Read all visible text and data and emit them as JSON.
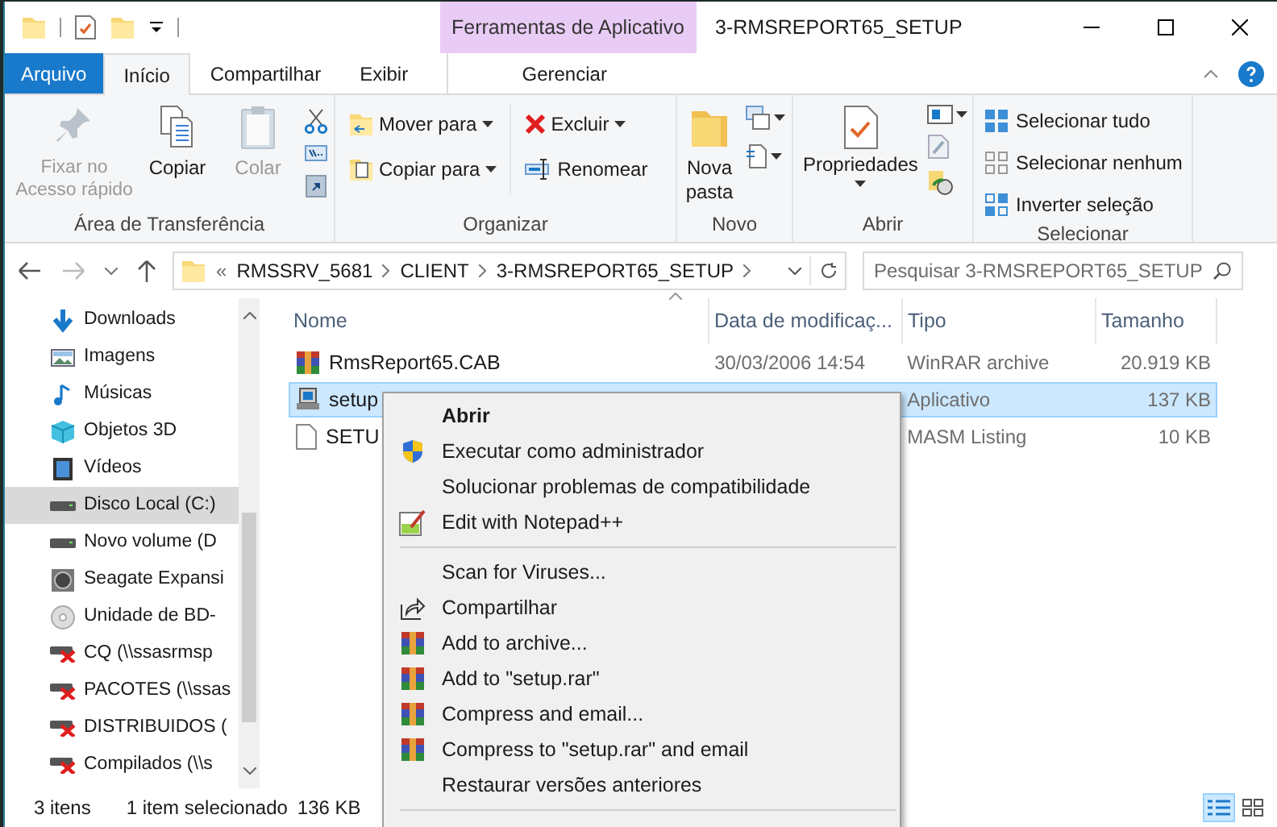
{
  "window": {
    "title": "3-RMSREPORT65_SETUP",
    "contextual_tab_group": "Ferramentas de Aplicativo"
  },
  "ribbon_tabs": [
    {
      "label": "Arquivo",
      "kind": "file",
      "selected": false
    },
    {
      "label": "Início",
      "kind": "tab",
      "selected": true
    },
    {
      "label": "Compartilhar",
      "kind": "tab",
      "selected": false
    },
    {
      "label": "Exibir",
      "kind": "tab",
      "selected": false
    },
    {
      "label": "Gerenciar",
      "kind": "contextual",
      "selected": false
    }
  ],
  "ribbon_groups": {
    "clipboard": {
      "label": "Área de Transferência",
      "buttons": [
        {
          "label": "Fixar no Acesso rápido",
          "disabled": true
        },
        {
          "label": "Copiar",
          "disabled": false
        },
        {
          "label": "Colar",
          "disabled": true
        }
      ]
    },
    "organize": {
      "label": "Organizar",
      "buttons": [
        {
          "label": "Mover para",
          "dropdown": true
        },
        {
          "label": "Copiar para",
          "dropdown": true
        },
        {
          "label": "Excluir",
          "dropdown": true
        },
        {
          "label": "Renomear",
          "dropdown": false
        }
      ]
    },
    "new": {
      "label": "Novo",
      "button": "Nova pasta"
    },
    "open": {
      "label": "Abrir",
      "button": "Propriedades"
    },
    "select": {
      "label": "Selecionar",
      "buttons": [
        "Selecionar tudo",
        "Selecionar nenhum",
        "Inverter seleção"
      ]
    }
  },
  "address_bar": {
    "overflow": "«",
    "path": [
      "RMSSRV_5681",
      "CLIENT",
      "3-RMSREPORT65_SETUP"
    ]
  },
  "search": {
    "placeholder": "Pesquisar 3-RMSREPORT65_SETUP"
  },
  "sidebar": {
    "items": [
      {
        "label": "Downloads",
        "kind": "downloads",
        "selected": false
      },
      {
        "label": "Imagens",
        "kind": "pictures",
        "selected": false
      },
      {
        "label": "Músicas",
        "kind": "music",
        "selected": false
      },
      {
        "label": "Objetos 3D",
        "kind": "objects",
        "selected": false
      },
      {
        "label": "Vídeos",
        "kind": "videos",
        "selected": false
      },
      {
        "label": "Disco Local (C:)",
        "kind": "drive",
        "selected": true
      },
      {
        "label": "Novo volume (D",
        "kind": "drive",
        "selected": false
      },
      {
        "label": "Seagate Expansi",
        "kind": "external",
        "selected": false
      },
      {
        "label": "Unidade de BD-",
        "kind": "disc",
        "selected": false
      },
      {
        "label": "CQ (\\\\ssasrmsp",
        "kind": "network",
        "selected": false
      },
      {
        "label": "PACOTES (\\\\ssas",
        "kind": "network",
        "selected": false
      },
      {
        "label": "DISTRIBUIDOS (",
        "kind": "network",
        "selected": false
      },
      {
        "label": "Compilados (\\\\s",
        "kind": "network",
        "selected": false
      }
    ]
  },
  "table": {
    "columns": [
      "Nome",
      "Data de modificaç...",
      "Tipo",
      "Tamanho"
    ],
    "rows": [
      {
        "name": "RmsReport65.CAB",
        "date": "30/03/2006 14:54",
        "type": "WinRAR archive",
        "size": "20.919 KB",
        "kind": "rar",
        "selected": false
      },
      {
        "name": "setup",
        "type": "Aplicativo",
        "size": "137 KB",
        "kind": "exe",
        "selected": true
      },
      {
        "name": "SETU",
        "type": "MASM Listing",
        "size": "10 KB",
        "kind": "doc",
        "selected": false
      }
    ]
  },
  "context_menu": {
    "items": [
      {
        "label": "Abrir",
        "kind": "default"
      },
      {
        "label": "Executar como administrador",
        "kind": "shield"
      },
      {
        "label": "Solucionar problemas de compatibilidade",
        "kind": "plain"
      },
      {
        "label": "Edit with Notepad++",
        "kind": "notepad"
      },
      {
        "kind": "separator"
      },
      {
        "label": "Scan for Viruses...",
        "kind": "plain"
      },
      {
        "label": "Compartilhar",
        "kind": "share"
      },
      {
        "label": "Add to archive...",
        "kind": "rar"
      },
      {
        "label": "Add to \"setup.rar\"",
        "kind": "rar"
      },
      {
        "label": "Compress and email...",
        "kind": "rar"
      },
      {
        "label": "Compress to \"setup.rar\" and email",
        "kind": "rar"
      },
      {
        "label": "Restaurar versões anteriores",
        "kind": "plain"
      },
      {
        "kind": "separator"
      }
    ]
  },
  "status_bar": {
    "item_count": "3 itens",
    "selection": "1 item selecionado",
    "selection_size": "136 KB"
  }
}
